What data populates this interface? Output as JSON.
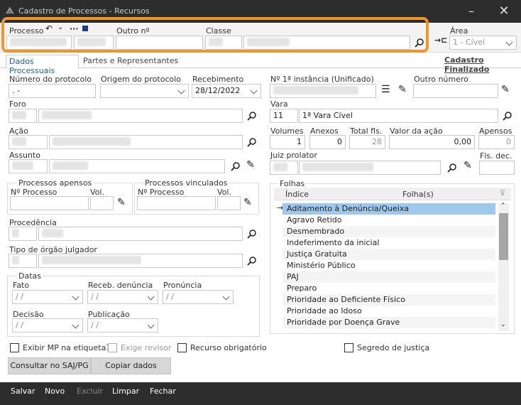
{
  "window": {
    "title": "Cadastro de Processos - Recursos"
  },
  "header": {
    "processo_label": "Processo",
    "outro_label": "Outro nº",
    "classe_label": "Classe",
    "area_label": "Área",
    "area_value": "1 - Cível"
  },
  "tabs": {
    "dados": "Dados Processuais",
    "partes": "Partes e Representantes",
    "cadastro": "Cadastro Finalizado"
  },
  "fields": {
    "num_protocolo_label": "Número do protocolo",
    "num_protocolo_value": ".      -",
    "origem_label": "Origem do protocolo",
    "recebimento_label": "Recebimento",
    "recebimento_value": "28/12/2022",
    "instancia_label": "Nº 1ª instância (Unificado)",
    "outro_numero_label": "Outro número",
    "foro_label": "Foro",
    "vara_label": "Vara",
    "vara_code": "11",
    "vara_name": "1ª Vara Cível",
    "acao_label": "Ação",
    "volumes_label": "Volumes",
    "volumes_value": "1",
    "anexos_label": "Anexos",
    "anexos_value": "0",
    "total_label": "Total fls.",
    "total_value": "28",
    "valor_label": "Valor da ação",
    "valor_value": "0,00",
    "apensos_label": "Apensos",
    "apensos_value": "0",
    "assunto_label": "Assunto",
    "juiz_label": "Juiz prolator",
    "fls_dec_label": "Fls. dec.",
    "proc_apensos": "Processos apensos",
    "proc_vinculados": "Processos vinculados",
    "nproc_label": "Nº Processo",
    "vol_label": "Vol.",
    "procedencia_label": "Procedência",
    "tipo_orgao_label": "Tipo de órgão julgador",
    "datas_label": "Datas",
    "fato_label": "Fato",
    "receb_den_label": "Receb. denúncia",
    "pronuncia_label": "Pronúncia",
    "decisao_label": "Decisão",
    "publicacao_label": "Publicação",
    "date_placeholder": "/ /"
  },
  "folhas": {
    "title": "Folhas",
    "col_indice": "Índice",
    "col_folhas": "Folha(s)",
    "items": [
      "Aditamento à Denúncia/Queixa",
      "Agravo Retido",
      "Desmembrado",
      "Indeferimento da inicial",
      "Justiça Gratuita",
      "Ministério Público",
      "PAJ",
      "Preparo",
      "Prioridade ao Deficiente Físico",
      "Prioridade ao Idoso",
      "Prioridade por Doença Grave"
    ]
  },
  "checks": {
    "exibir": "Exibir MP na etiqueta?",
    "exige": "Exige revisor",
    "recurso": "Recurso obrigatório",
    "segredo": "Segredo de justiça"
  },
  "buttons": {
    "consultar": "Consultar no SAJ/PG",
    "copiar": "Copiar dados"
  },
  "footer": {
    "salvar": "Salvar",
    "novo": "Novo",
    "excluir": "Excluir",
    "limpar": "Limpar",
    "fechar": "Fechar"
  }
}
